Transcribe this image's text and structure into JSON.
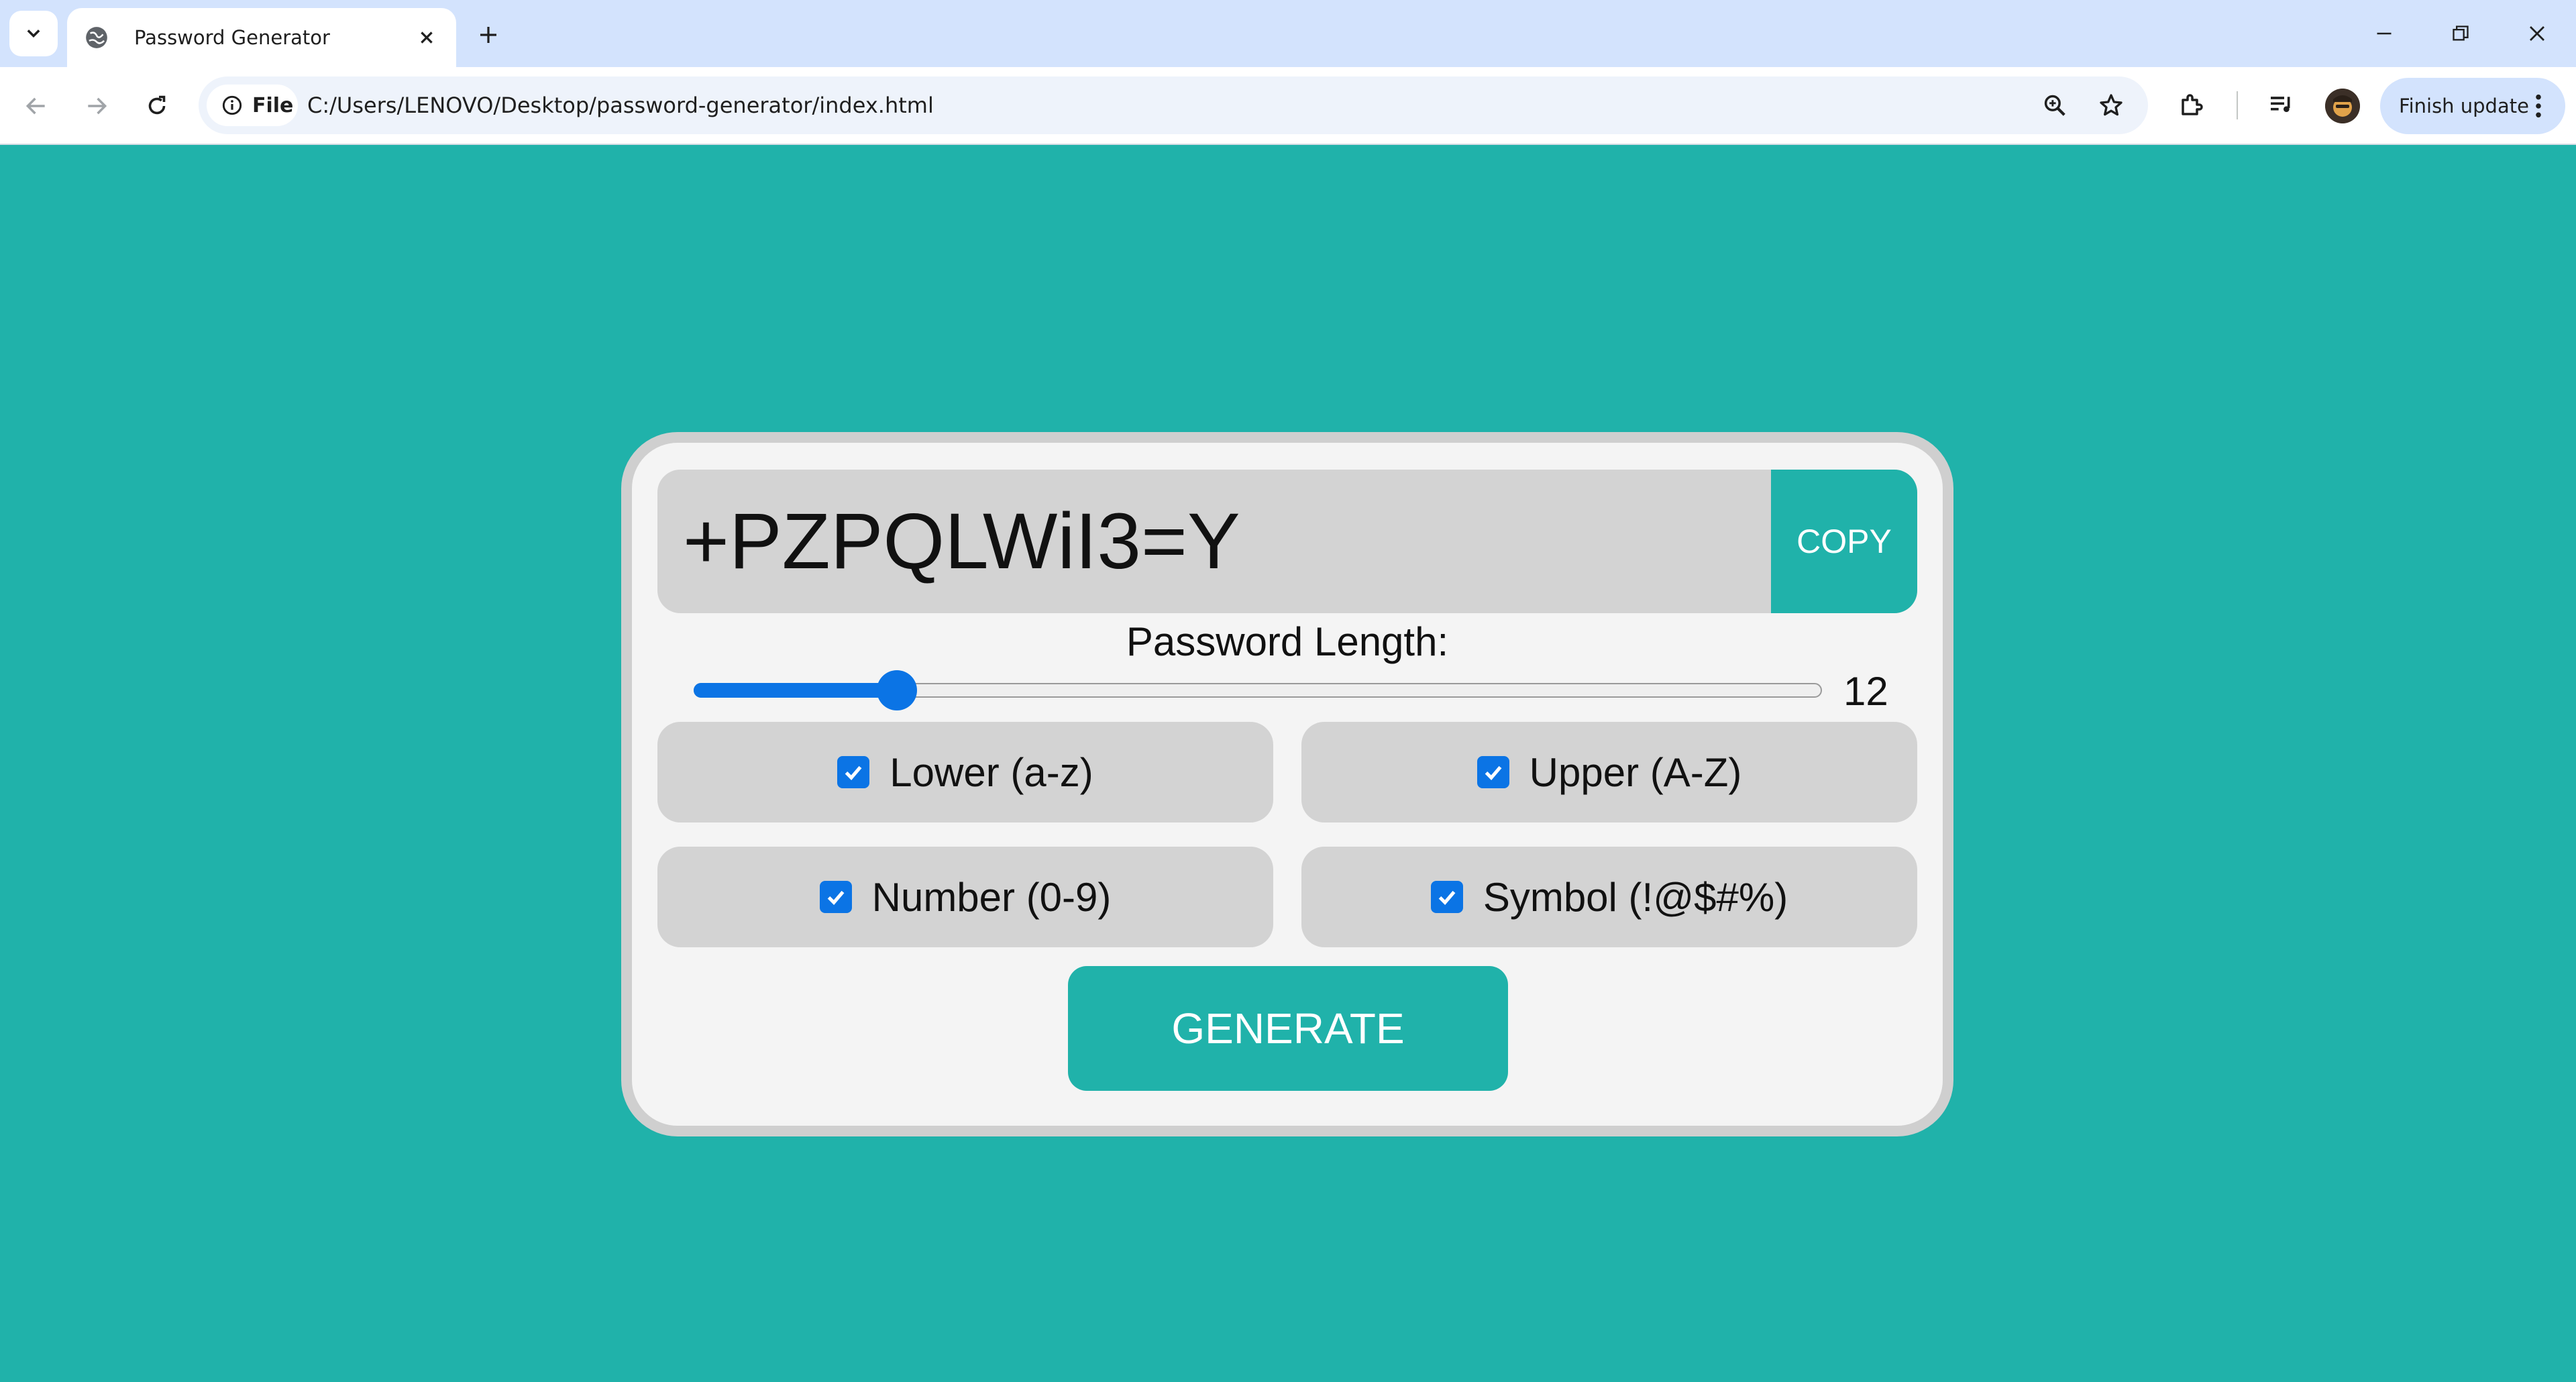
{
  "browser": {
    "tab_title": "Password Generator",
    "site_chip_label": "File",
    "url": "C:/Users/LENOVO/Desktop/password-generator/index.html",
    "finish_update_label": "Finish update",
    "icons": {
      "tab_search": "chevron-down-icon",
      "favicon": "globe-icon",
      "tab_close": "close-icon",
      "new_tab": "plus-icon",
      "minimize": "minimize-icon",
      "restore": "restore-icon",
      "close_window": "close-icon",
      "back": "arrow-left-icon",
      "forward": "arrow-right-icon",
      "reload": "reload-icon",
      "info": "info-icon",
      "zoom": "zoom-icon",
      "bookmark": "star-icon",
      "extensions": "puzzle-icon",
      "media": "playlist-icon",
      "profile": "avatar",
      "menu": "kebab-menu-icon"
    }
  },
  "app": {
    "password": "+PZPQLWiI3=Y",
    "copy_label": "COPY",
    "length_label": "Password Length:",
    "length_value": "12",
    "length_fraction": 0.18,
    "options": [
      {
        "label": "Lower (a-z)",
        "checked": true
      },
      {
        "label": "Upper (A-Z)",
        "checked": true
      },
      {
        "label": "Number (0-9)",
        "checked": true
      },
      {
        "label": "Symbol (!@$#%)",
        "checked": true
      }
    ],
    "generate_label": "GENERATE"
  },
  "colors": {
    "page_background": "#20b2aa",
    "accent": "#20b2aa",
    "slider_accent": "#0b74e5",
    "card_background": "#f4f4f4",
    "field_background": "#d3d3d3"
  }
}
